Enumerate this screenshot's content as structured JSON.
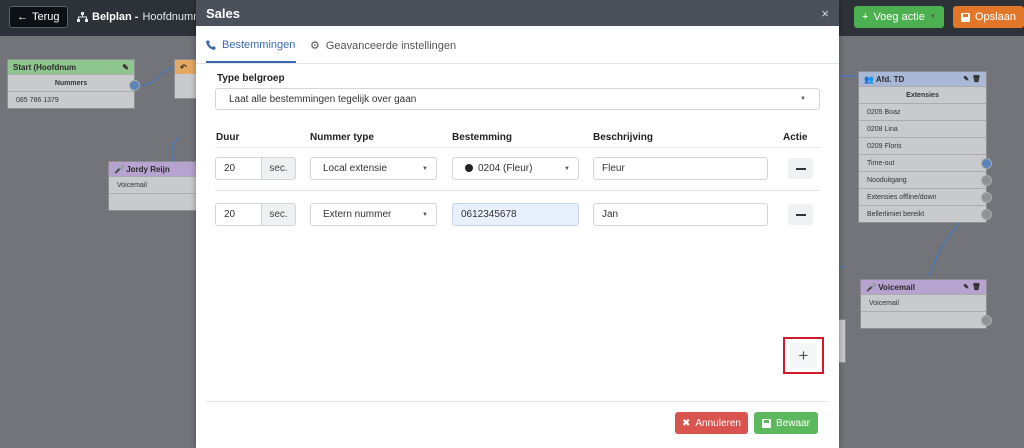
{
  "app": {
    "back_label": "Terug",
    "breadcrumb_bold": "Belplan -",
    "breadcrumb_rest": "Hoofdnumme",
    "voeg_actie_label": "Voeg actie",
    "opslaan_label": "Opslaan"
  },
  "canvas": {
    "start_node": {
      "title": "Start (Hoofdnum",
      "header": "Nummers",
      "number": "085 786 1379"
    },
    "jordy_node": {
      "title": "Jordy Reijn",
      "row": "Voicemail"
    },
    "afd_node": {
      "title": "Afd. TD",
      "header": "Extensies",
      "rows": [
        "0205 Boaz",
        "0208 Lina",
        "0209 Floris",
        "Time-out",
        "Nooduitgang",
        "Extensies offline/down",
        "Bellerlimiet bereikt"
      ]
    },
    "voicemail_node": {
      "title": "Voicemail",
      "row": "Voicemail"
    }
  },
  "modal": {
    "title": "Sales",
    "close_symbol": "×",
    "tabs": [
      {
        "label": "Bestemmingen",
        "active": true
      },
      {
        "label": "Geavanceerde instellingen",
        "active": false
      }
    ],
    "type_label": "Type belgroep",
    "type_value": "Laat alle bestemmingen tegelijk over gaan",
    "columns": {
      "duur": "Duur",
      "nummer_type": "Nummer type",
      "bestemming": "Bestemming",
      "beschrijving": "Beschrijving",
      "actie": "Actie"
    },
    "rows": [
      {
        "duur": "20",
        "unit": "sec.",
        "nummer_type": "Local extensie",
        "bestemming": "0204 (Fleur)",
        "beschrijving": "Fleur"
      },
      {
        "duur": "20",
        "unit": "sec.",
        "nummer_type": "Extern nummer",
        "bestemming": "0612345678",
        "beschrijving": "Jan"
      }
    ],
    "add_symbol": "+",
    "annuleren_label": "Annuleren",
    "bewaar_label": "Bewaar"
  },
  "colors": {
    "accent": "#3a6ab1",
    "danger": "#d9534f",
    "success": "#5cb85c",
    "highlight": "#d4192c"
  }
}
